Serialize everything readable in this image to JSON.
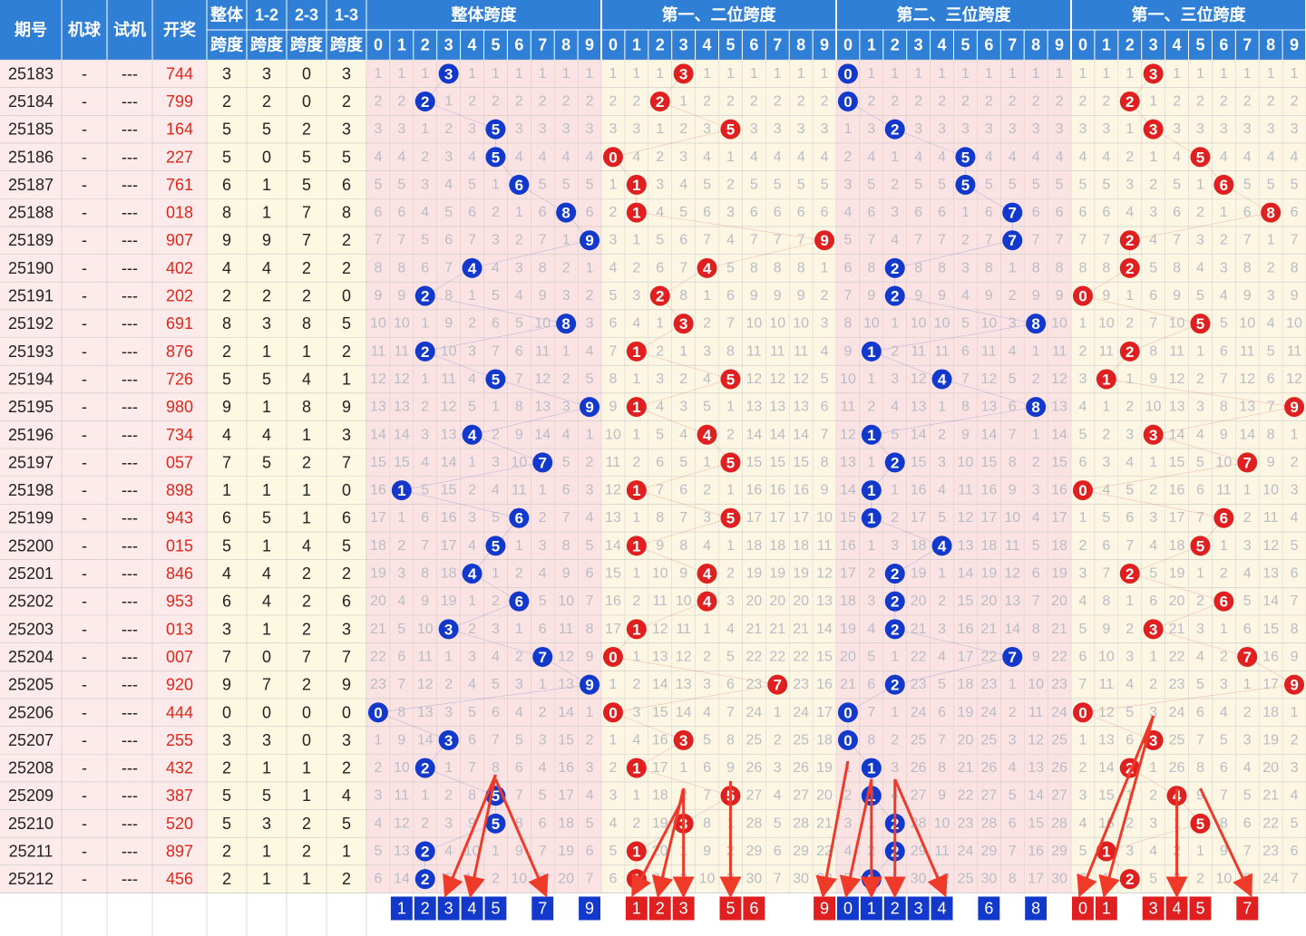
{
  "chart_data": {
    "type": "table",
    "title": "",
    "headers": {
      "info": [
        "期号",
        "机球",
        "试机",
        "开奖"
      ],
      "spans": [
        [
          "整体",
          "跨度"
        ],
        [
          "1-2",
          "跨度"
        ],
        [
          "2-3",
          "跨度"
        ],
        [
          "1-3",
          "跨度"
        ]
      ],
      "groups": [
        "整体跨度",
        "第一、二位跨度",
        "第二、三位跨度",
        "第一、三位跨度"
      ],
      "digits": [
        "0",
        "1",
        "2",
        "3",
        "4",
        "5",
        "6",
        "7",
        "8",
        "9"
      ]
    },
    "rows": [
      {
        "issue": "25183",
        "ball": "-",
        "trial": "---",
        "draw": "744"
      },
      {
        "issue": "25184",
        "ball": "-",
        "trial": "---",
        "draw": "799"
      },
      {
        "issue": "25185",
        "ball": "-",
        "trial": "---",
        "draw": "164"
      },
      {
        "issue": "25186",
        "ball": "-",
        "trial": "---",
        "draw": "227"
      },
      {
        "issue": "25187",
        "ball": "-",
        "trial": "---",
        "draw": "761"
      },
      {
        "issue": "25188",
        "ball": "-",
        "trial": "---",
        "draw": "018"
      },
      {
        "issue": "25189",
        "ball": "-",
        "trial": "---",
        "draw": "907"
      },
      {
        "issue": "25190",
        "ball": "-",
        "trial": "---",
        "draw": "402"
      },
      {
        "issue": "25191",
        "ball": "-",
        "trial": "---",
        "draw": "202"
      },
      {
        "issue": "25192",
        "ball": "-",
        "trial": "---",
        "draw": "691"
      },
      {
        "issue": "25193",
        "ball": "-",
        "trial": "---",
        "draw": "876"
      },
      {
        "issue": "25194",
        "ball": "-",
        "trial": "---",
        "draw": "726"
      },
      {
        "issue": "25195",
        "ball": "-",
        "trial": "---",
        "draw": "980"
      },
      {
        "issue": "25196",
        "ball": "-",
        "trial": "---",
        "draw": "734"
      },
      {
        "issue": "25197",
        "ball": "-",
        "trial": "---",
        "draw": "057"
      },
      {
        "issue": "25198",
        "ball": "-",
        "trial": "---",
        "draw": "898"
      },
      {
        "issue": "25199",
        "ball": "-",
        "trial": "---",
        "draw": "943"
      },
      {
        "issue": "25200",
        "ball": "-",
        "trial": "---",
        "draw": "015"
      },
      {
        "issue": "25201",
        "ball": "-",
        "trial": "---",
        "draw": "846"
      },
      {
        "issue": "25202",
        "ball": "-",
        "trial": "---",
        "draw": "953"
      },
      {
        "issue": "25203",
        "ball": "-",
        "trial": "---",
        "draw": "013"
      },
      {
        "issue": "25204",
        "ball": "-",
        "trial": "---",
        "draw": "007"
      },
      {
        "issue": "25205",
        "ball": "-",
        "trial": "---",
        "draw": "920"
      },
      {
        "issue": "25206",
        "ball": "-",
        "trial": "---",
        "draw": "444"
      },
      {
        "issue": "25207",
        "ball": "-",
        "trial": "---",
        "draw": "255"
      },
      {
        "issue": "25208",
        "ball": "-",
        "trial": "---",
        "draw": "432"
      },
      {
        "issue": "25209",
        "ball": "-",
        "trial": "---",
        "draw": "387"
      },
      {
        "issue": "25210",
        "ball": "-",
        "trial": "---",
        "draw": "520"
      },
      {
        "issue": "25211",
        "ball": "-",
        "trial": "---",
        "draw": "897"
      },
      {
        "issue": "25212",
        "ball": "-",
        "trial": "---",
        "draw": "456"
      }
    ],
    "footer_selected": [
      [
        1,
        2,
        3,
        4,
        5,
        7,
        9
      ],
      [
        1,
        2,
        3,
        5,
        6,
        9
      ],
      [
        0,
        1,
        2,
        3,
        4,
        6,
        8
      ],
      [
        0,
        1,
        3,
        4,
        5,
        7
      ]
    ],
    "colors": {
      "header": "#2f7fd6",
      "info_bg": "#fdeaea",
      "span_bg": "#fdf8e2",
      "odd_bg": "#fbe3e3",
      "even_bg": "#fcf6e3",
      "blue_ball": "#1238cc",
      "red_ball": "#e02020",
      "draw_text": "#e0261b",
      "arrow": "#ef3a2a",
      "grid": "#c8c8c8"
    }
  }
}
